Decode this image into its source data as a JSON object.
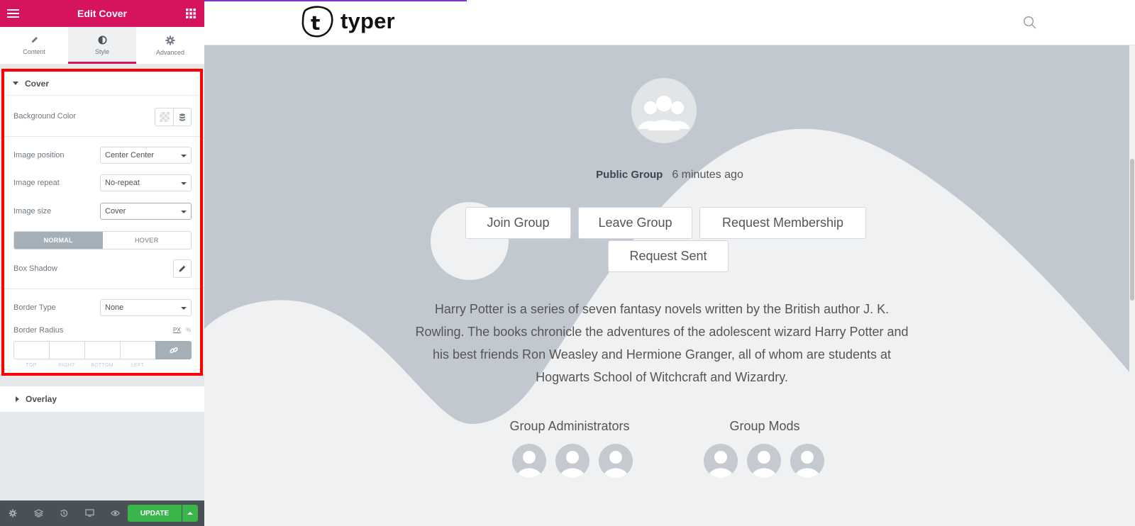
{
  "panel": {
    "title": "Edit Cover",
    "tabs": [
      {
        "label": "Content",
        "icon": "pencil-icon"
      },
      {
        "label": "Style",
        "icon": "half-circle-icon"
      },
      {
        "label": "Advanced",
        "icon": "gear-icon"
      }
    ],
    "active_tab": "Style",
    "section_cover": "Cover",
    "bg_color_label": "Background Color",
    "image_position": {
      "label": "Image position",
      "value": "Center Center"
    },
    "image_repeat": {
      "label": "Image repeat",
      "value": "No-repeat"
    },
    "image_size": {
      "label": "Image size",
      "value": "Cover"
    },
    "toggle": {
      "normal": "NORMAL",
      "hover": "HOVER"
    },
    "box_shadow_label": "Box Shadow",
    "border_type": {
      "label": "Border Type",
      "value": "None"
    },
    "border_radius": {
      "label": "Border Radius",
      "unit_px": "PX",
      "unit_pct": "%",
      "sides": [
        "TOP",
        "RIGHT",
        "BOTTOM",
        "LEFT"
      ]
    },
    "section_overlay": "Overlay",
    "update_label": "UPDATE",
    "accent": "#d5135f",
    "highlight_color": "#ff0000",
    "update_color": "#39b54a"
  },
  "preview": {
    "logo_text": "typer",
    "group_type": "Public Group",
    "time_ago": "6 minutes ago",
    "buttons": {
      "join": "Join Group",
      "leave": "Leave Group",
      "request": "Request Membership",
      "sent": "Request Sent"
    },
    "description": "Harry Potter is a series of seven fantasy novels written by the British author J. K. Rowling. The books chronicle the adventures of the adolescent wizard Harry Potter and his best friends Ron Weasley and Hermione Granger, all of whom are students at Hogwarts School of Witchcraft and Wizardry.",
    "admins_title": "Group Administrators",
    "mods_title": "Group Mods",
    "cover_color": "#c2c8cf"
  }
}
